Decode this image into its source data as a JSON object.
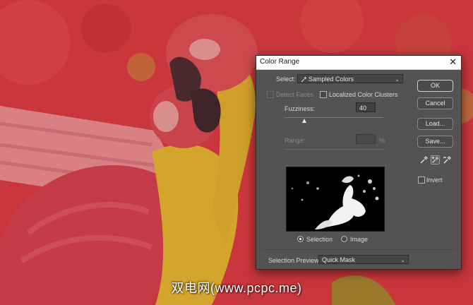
{
  "dialog": {
    "title": "Color Range",
    "close_glyph": "✕"
  },
  "select": {
    "label": "Select:",
    "value": "Sampled Colors",
    "icon": "eyedropper-icon"
  },
  "detect_faces": {
    "label": "Detect Faces",
    "checked": false,
    "enabled": false
  },
  "localized_clusters": {
    "label": "Localized Color Clusters",
    "checked": false
  },
  "fuzziness": {
    "label": "Fuzziness:",
    "value": "40",
    "level_fraction": 0.2
  },
  "range": {
    "label": "Range:",
    "value": "",
    "unit": "%"
  },
  "preview_mode": {
    "options": [
      {
        "label": "Selection",
        "selected": true
      },
      {
        "label": "Image",
        "selected": false
      }
    ]
  },
  "selection_preview": {
    "label": "Selection Preview:",
    "value": "Quick Mask"
  },
  "buttons": {
    "ok": "OK",
    "cancel": "Cancel",
    "load": "Load...",
    "save": "Save..."
  },
  "tools": [
    "eyedropper-icon",
    "eyedropper-plus-icon",
    "eyedropper-minus-icon"
  ],
  "invert": {
    "label": "Invert",
    "checked": false
  },
  "watermark": "双电网(www.pcpc.me)",
  "colors": {
    "mask_red": "#c8343a",
    "dialog_bg": "#535353",
    "title_bg": "#ffffff"
  }
}
